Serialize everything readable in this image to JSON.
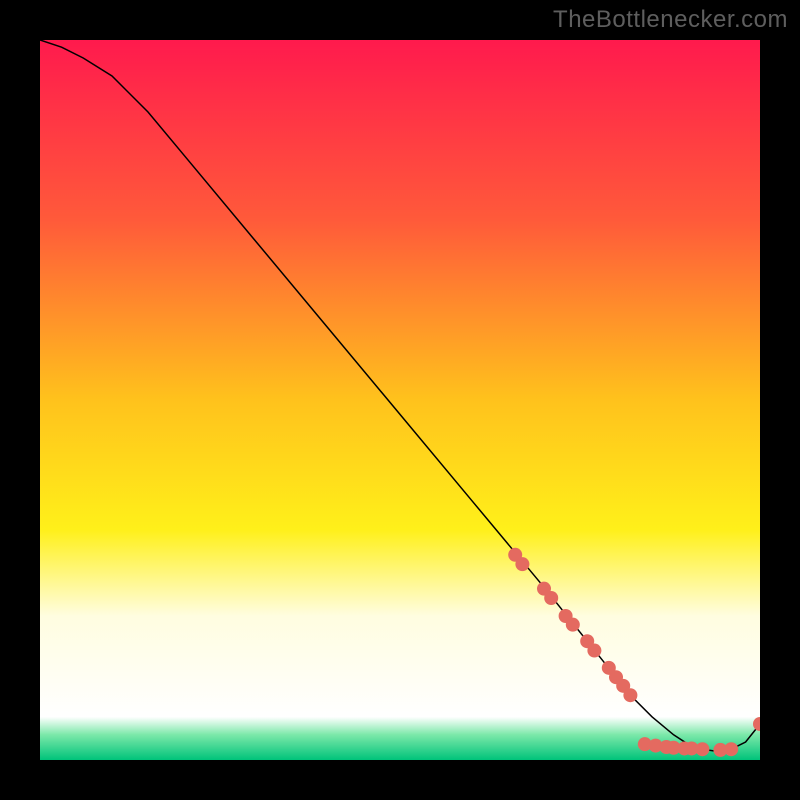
{
  "watermark": "TheBottlenecker.com",
  "chart_data": {
    "type": "line",
    "title": "",
    "xlabel": "",
    "ylabel": "",
    "xlim": [
      0,
      100
    ],
    "ylim": [
      0,
      100
    ],
    "grid": false,
    "background_gradient": {
      "stops": [
        {
          "offset": 0.0,
          "color": "#ff1a4d"
        },
        {
          "offset": 0.25,
          "color": "#ff5a3a"
        },
        {
          "offset": 0.5,
          "color": "#ffc21c"
        },
        {
          "offset": 0.68,
          "color": "#fff01a"
        },
        {
          "offset": 0.8,
          "color": "#fffde0"
        },
        {
          "offset": 0.94,
          "color": "#ffffff"
        },
        {
          "offset": 0.965,
          "color": "#7be8a9"
        },
        {
          "offset": 1.0,
          "color": "#00c37a"
        }
      ]
    },
    "series": [
      {
        "name": "bottleneck-curve",
        "stroke": "#000000",
        "stroke_width": 1.5,
        "x": [
          0,
          3,
          6,
          10,
          15,
          20,
          30,
          40,
          50,
          60,
          70,
          78,
          82,
          85,
          88,
          90,
          92,
          94,
          96,
          98,
          100
        ],
        "y": [
          100,
          99,
          97.5,
          95,
          90,
          84,
          72,
          60,
          48,
          36,
          24,
          14,
          9,
          6,
          3.5,
          2.2,
          1.5,
          1.2,
          1.5,
          2.5,
          5
        ]
      }
    ],
    "markers": {
      "color": "#e46a60",
      "radius": 7,
      "points": [
        {
          "x": 66,
          "y": 28.5
        },
        {
          "x": 67,
          "y": 27.2
        },
        {
          "x": 70,
          "y": 23.8
        },
        {
          "x": 71,
          "y": 22.5
        },
        {
          "x": 73,
          "y": 20.0
        },
        {
          "x": 74,
          "y": 18.8
        },
        {
          "x": 76,
          "y": 16.5
        },
        {
          "x": 77,
          "y": 15.2
        },
        {
          "x": 79,
          "y": 12.8
        },
        {
          "x": 80,
          "y": 11.5
        },
        {
          "x": 81,
          "y": 10.3
        },
        {
          "x": 82,
          "y": 9.0
        },
        {
          "x": 84,
          "y": 2.2
        },
        {
          "x": 85.5,
          "y": 2.0
        },
        {
          "x": 87,
          "y": 1.8
        },
        {
          "x": 88,
          "y": 1.7
        },
        {
          "x": 89.5,
          "y": 1.6
        },
        {
          "x": 90.5,
          "y": 1.6
        },
        {
          "x": 92,
          "y": 1.5
        },
        {
          "x": 94.5,
          "y": 1.4
        },
        {
          "x": 96,
          "y": 1.5
        },
        {
          "x": 100,
          "y": 5.0
        }
      ]
    }
  }
}
